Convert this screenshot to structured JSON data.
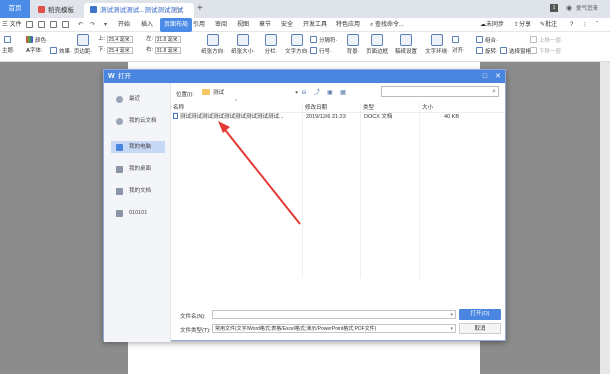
{
  "tabs": {
    "home": "首页",
    "template": "稻壳模板",
    "doc": "测试测试测试...测试测试测试"
  },
  "window_controls": {
    "badge": "1",
    "user": "爱气您来"
  },
  "menu": {
    "file": "三 文件",
    "items": [
      "开始",
      "插入",
      "页面布局",
      "引用",
      "审阅",
      "视图",
      "章节",
      "安全",
      "开发工具",
      "特色应用"
    ],
    "active_index": 2,
    "search": "查找命令...",
    "sync": "未同步",
    "share": "分享",
    "comment": "批注"
  },
  "ribbon": {
    "theme": "主题·",
    "color": "颜色·",
    "font": "字体·",
    "effect": "效果·",
    "margin": "页边距·",
    "top_label": "上:",
    "top_value": "25.4 毫米",
    "bottom_label": "下:",
    "bottom_value": "25.4 毫米",
    "left_label": "左:",
    "left_value": "31.8 毫米",
    "right_label": "右:",
    "right_value": "31.8 毫米",
    "orientation": "纸张方向·",
    "size": "纸张大小·",
    "columns": "分栏·",
    "text_direction": "文字方向·",
    "line_number": "行号·",
    "separator": "分隔符·",
    "background": "背景·",
    "border": "页面边框",
    "draft": "稿纸设置",
    "wrap": "文字环绕·",
    "align": "对齐·",
    "rotate": "旋转·",
    "group": "组合·",
    "select_pane": "选择窗格",
    "up": "上移一层·",
    "down": "下移一层·"
  },
  "dialog": {
    "title": "打开",
    "sidebar": [
      {
        "label": "最近",
        "icon": "clock-icon"
      },
      {
        "label": "我的云文档",
        "icon": "cloud-icon"
      },
      {
        "label": "我的电脑",
        "icon": "computer-icon"
      },
      {
        "label": "我的桌面",
        "icon": "desktop-icon"
      },
      {
        "label": "我的文档",
        "icon": "documents-icon"
      },
      {
        "label": "010101",
        "icon": "folder-icon"
      }
    ],
    "active_sidebar_index": 2,
    "location_label": "位置(I):",
    "location_value": "测试",
    "search_placeholder": "",
    "columns": {
      "name": "名称",
      "date": "修改日期",
      "type": "类型",
      "size": "大小"
    },
    "files": [
      {
        "name": "测试测试测试测试测试测试测试测试测试...",
        "date": "2019/12/6 21:23",
        "type": "DOCX 文档",
        "size": "40 KB"
      }
    ],
    "filename_label": "文件名(N):",
    "filename_value": "",
    "filetype_label": "文件类型(T):",
    "filetype_value": "常用文件(文字/Word格式;表格/Excel格式;演示/PowerPoint格式;PDF文件)",
    "open_button": "打开(O)",
    "cancel_button": "取消"
  },
  "colors": {
    "accent": "#4a86e0",
    "annotation_arrow": "#e53935",
    "folder": "#f5c760"
  }
}
